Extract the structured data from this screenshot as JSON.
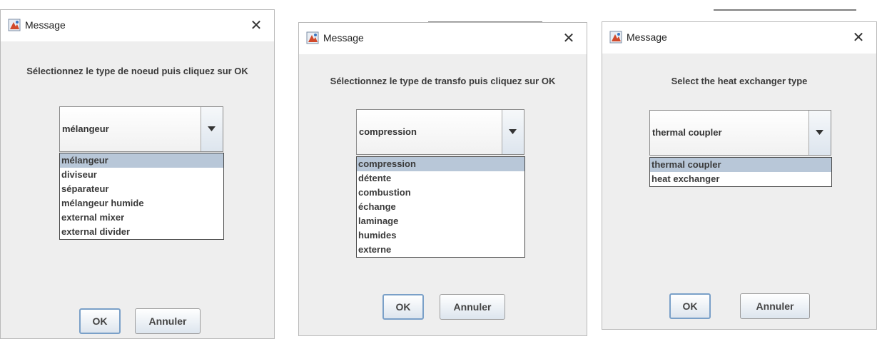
{
  "dialogs": [
    {
      "title": "Message",
      "close_glyph": "✕",
      "prompt": "Sélectionnez le type de noeud puis cliquez sur OK",
      "combo_value": "mélangeur",
      "options": [
        "mélangeur",
        "diviseur",
        "séparateur",
        "mélangeur humide",
        "external mixer",
        "external divider"
      ],
      "selected_index": 0,
      "ok_label": "OK",
      "cancel_label": "Annuler"
    },
    {
      "title": "Message",
      "close_glyph": "✕",
      "prompt": "Sélectionnez le type de transfo puis cliquez sur OK",
      "combo_value": "compression",
      "options": [
        "compression",
        "détente",
        "combustion",
        "échange",
        "laminage",
        "humides",
        "externe"
      ],
      "selected_index": 0,
      "ok_label": "OK",
      "cancel_label": "Annuler"
    },
    {
      "title": "Message",
      "close_glyph": "✕",
      "prompt": "Select the heat exchanger type",
      "combo_value": "thermal coupler",
      "options": [
        "thermal coupler",
        "heat exchanger"
      ],
      "selected_index": 0,
      "ok_label": "OK",
      "cancel_label": "Annuler"
    }
  ],
  "icons": {
    "app_icon": "java-app-icon",
    "close_icon": "close-icon",
    "dropdown_arrow": "chevron-down-icon"
  },
  "colors": {
    "dialog_bg": "#eeeeee",
    "selection": "#b8c7d8",
    "button_focus_border": "#7aa0c8"
  }
}
